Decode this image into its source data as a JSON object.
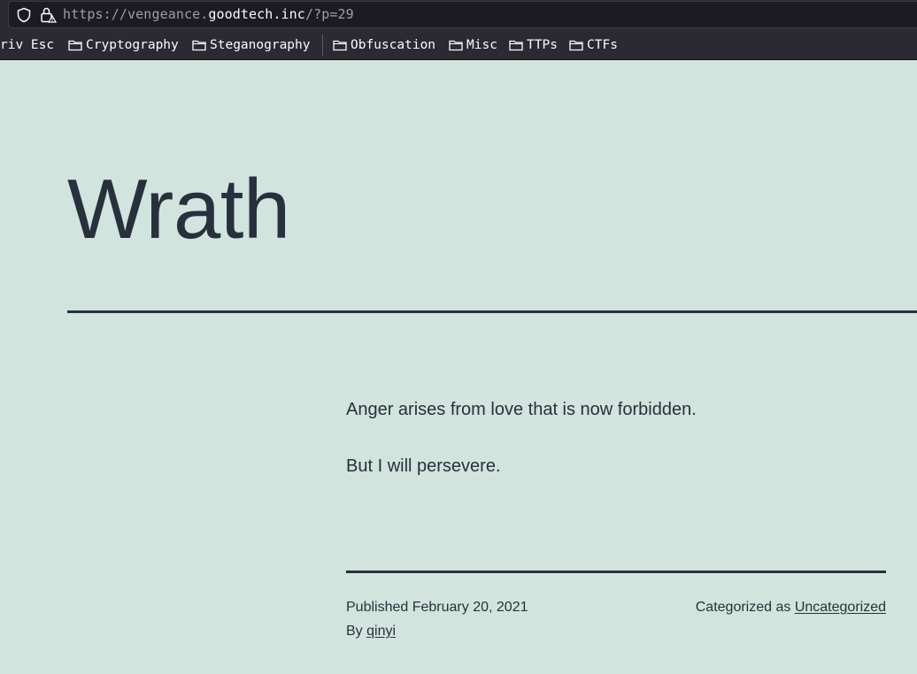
{
  "browser": {
    "url_scheme": "https://",
    "url_subdomain": "vengeance.",
    "url_host": "goodtech.inc",
    "url_path": "/?p=29",
    "bookmarks": [
      {
        "label": "riv Esc",
        "icon": "none"
      },
      {
        "label": "Cryptography",
        "icon": "folder-icon"
      },
      {
        "label": "Steganography",
        "icon": "folder-icon"
      },
      {
        "label": "Obfuscation",
        "icon": "folder-icon"
      },
      {
        "label": "Misc",
        "icon": "folder-icon"
      },
      {
        "label": "TTPs",
        "icon": "folder-icon"
      },
      {
        "label": "CTFs",
        "icon": "folder-icon"
      }
    ]
  },
  "post": {
    "title": "Wrath",
    "paragraphs": [
      "Anger arises from love that is now forbidden.",
      "But I will persevere."
    ],
    "published_label": "Published",
    "published_date": "February 20, 2021",
    "by_label": "By",
    "author": "qinyi",
    "category_label": "Categorized as",
    "category": "Uncategorized"
  },
  "colors": {
    "page_background": "#d1e4dd",
    "text": "#28303d",
    "chrome_background": "#2b2a33",
    "urlbar_background": "#1c1b22"
  }
}
